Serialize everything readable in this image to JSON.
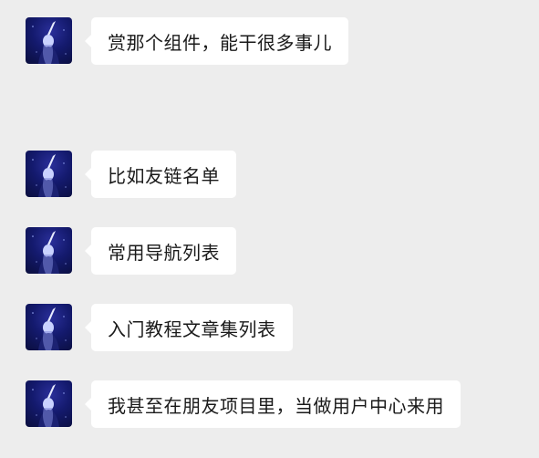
{
  "chat": {
    "background": "#ededed",
    "bubble_color": "#ffffff",
    "messages": [
      {
        "text": "赏那个组件，能干很多事儿",
        "avatar_icon": "user-avatar-icon"
      },
      {
        "text": "比如友链名单",
        "avatar_icon": "user-avatar-icon"
      },
      {
        "text": "常用导航列表",
        "avatar_icon": "user-avatar-icon"
      },
      {
        "text": "入门教程文章集列表",
        "avatar_icon": "user-avatar-icon"
      },
      {
        "text": "我甚至在朋友项目里，当做用户中心来用",
        "avatar_icon": "user-avatar-icon"
      }
    ]
  }
}
